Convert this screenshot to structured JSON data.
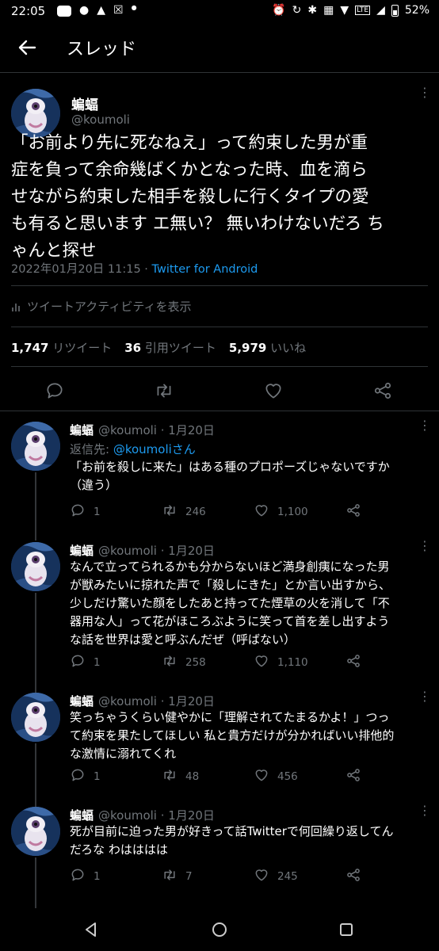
{
  "status_bar": {
    "time": "22:05",
    "battery": "52%",
    "left_icons": [
      "line-icon",
      "person-icon",
      "drive-icon",
      "x-box-icon",
      "dot-icon"
    ],
    "right_icons": [
      "alarm-icon",
      "sync-icon",
      "bluetooth-icon",
      "vibrate-icon",
      "wifi-icon",
      "lte-icon",
      "signal-icon",
      "battery-icon"
    ]
  },
  "appbar": {
    "title": "スレッド"
  },
  "main_tweet": {
    "name": "蝙蝠",
    "handle": "@koumoli",
    "text": "「お前より先に死なねえ」って約束した男が重\n症を負って余命幾ばくかとなった時、血を滴ら\nせながら約束した相手を殺しに行くタイプの愛\nも有ると思います エ無い？ 無いわけないだろ ち\nゃんと探せ",
    "datetime": "2022年01月20日 11:15 · ",
    "source": "Twitter for Android",
    "activity_label": "ツイートアクティビティを表示",
    "stats": {
      "retweets_count": "1,747",
      "retweets_label": "リツイート",
      "quotes_count": "36",
      "quotes_label": "引用ツイート",
      "likes_count": "5,979",
      "likes_label": "いいね"
    }
  },
  "replies": [
    {
      "name": "蝙蝠",
      "handle_date": "@koumoli · 1月20日",
      "replyto_label": "返信先: ",
      "replyto_user": "@koumoliさん",
      "text": "「お前を殺しに来た」はある種のプロポーズじゃないですか\n（違う）",
      "replies": "1",
      "retweets": "246",
      "likes": "1,100"
    },
    {
      "name": "蝙蝠",
      "handle_date": "@koumoli · 1月20日",
      "text": "なんで立ってられるかも分からないほど満身創痍になった男\nが獣みたいに掠れた声で「殺しにきた」とか言い出すから、\n少しだけ驚いた顔をしたあと持ってた煙草の火を消して「不\n器用な人」って花がほころぶように笑って首を差し出すよう\nな話を世界は愛と呼ぶんだぜ（呼ばない）",
      "replies": "1",
      "retweets": "258",
      "likes": "1,110"
    },
    {
      "name": "蝙蝠",
      "handle_date": "@koumoli · 1月20日",
      "text": "笑っちゃうくらい健やかに「理解されてたまるかよ！」つっ\nて約束を果たしてほしい 私と貴方だけが分かればいい排他的\nな激情に溺れてくれ",
      "replies": "1",
      "retweets": "48",
      "likes": "456"
    },
    {
      "name": "蝙蝠",
      "handle_date": "@koumoli · 1月20日",
      "text": "死が目前に迫った男が好きって話Twitterで何回繰り返してん\nだろな わはははは",
      "replies": "1",
      "retweets": "7",
      "likes": "245"
    }
  ],
  "colors": {
    "background": "#000000",
    "text": "#e7e9ea",
    "muted": "#71767b",
    "link": "#1d9bf0",
    "divider": "#2f3336"
  }
}
